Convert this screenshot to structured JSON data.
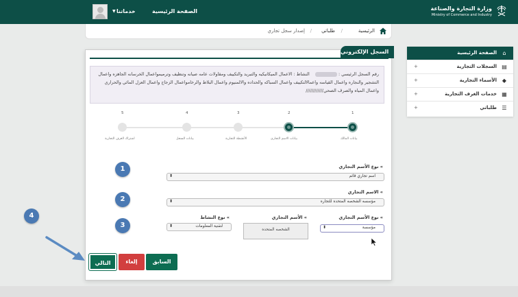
{
  "header": {
    "logo_ar": "وزارة التجارة والصناعة",
    "logo_en": "Ministry of Commerce and Industry",
    "nav_home": "الصفحة الرئيسية",
    "nav_services": "خدماتنا"
  },
  "breadcrumb": {
    "home": "الرئيسية",
    "requests": "طلباتي",
    "current": "إصدار سجل تجاري",
    "sep": "/"
  },
  "sidebar": {
    "items": [
      {
        "label": "الصفحة الرئيسية",
        "icon": "home-icon",
        "active": true
      },
      {
        "label": "السجلات التجارية",
        "icon": "documents-icon",
        "expand": "+"
      },
      {
        "label": "الأسماء التجارية",
        "icon": "tag-icon",
        "expand": "+"
      },
      {
        "label": "خدمات الغرف التجارية",
        "icon": "building-icon",
        "expand": "+"
      },
      {
        "label": "طلباتي",
        "icon": "list-icon",
        "expand": "+"
      }
    ]
  },
  "card": {
    "title": "السجل الإلكتروني",
    "info": {
      "reg_label": "رقم السجل الرئيسي :",
      "activity_label": "النشاط :",
      "activity_text": "الاعمال الميكانيكيه والتبريد والتكييف ومقاولات عامه صيانه وتنظيف وترميمواعمال الخرسانه الجاهزه واعمال التشجير والنجاره واعمال القياسه واعمالالتكييف واعمال السباكه والحداده والالمنيوم واعمال البلاط والرخامواعمال الزجاج واعمال العزل المائي والحراري واعمال المياه والصرف الصحي////////////"
    },
    "steps": [
      {
        "num": "1",
        "label": "بيانات المالك",
        "state": "done"
      },
      {
        "num": "2",
        "label": "بيانات الاسم التجاري",
        "state": "done"
      },
      {
        "num": "3",
        "label": "الأنشطة التجارية",
        "state": "todo"
      },
      {
        "num": "4",
        "label": "بيانات السجل",
        "state": "todo"
      },
      {
        "num": "5",
        "label": "اشتراك الغرف التجارية",
        "state": "todo"
      }
    ],
    "fields": {
      "trade_name_type_label": "» نوع الأسم التجاري",
      "trade_name_type_value": "اسم تجاري قائم",
      "trade_name_label": "» الاسم التجاري",
      "trade_name_value": "مؤسسه الشخصه المتحده للتجاره",
      "name_type2_label": "» نوع الأسم التجاري",
      "name_type2_value": "مؤسسة",
      "trade_name2_label": "» الأسم التجاري",
      "trade_name2_value": "الشخصه المتحده",
      "activity_type_label": "» نوع النشاط",
      "activity_type_value": "لتقنية المعلومات"
    },
    "buttons": {
      "previous": "السابق",
      "cancel": "إلغاء",
      "next": "التالي"
    }
  },
  "annotations": [
    "1",
    "2",
    "3",
    "4"
  ],
  "colors": {
    "brand": "#0d4f47",
    "button_green": "#0d6d52",
    "button_red": "#d23f3f",
    "badge_blue": "#4a79b3",
    "info_bg": "#f1eef5"
  }
}
